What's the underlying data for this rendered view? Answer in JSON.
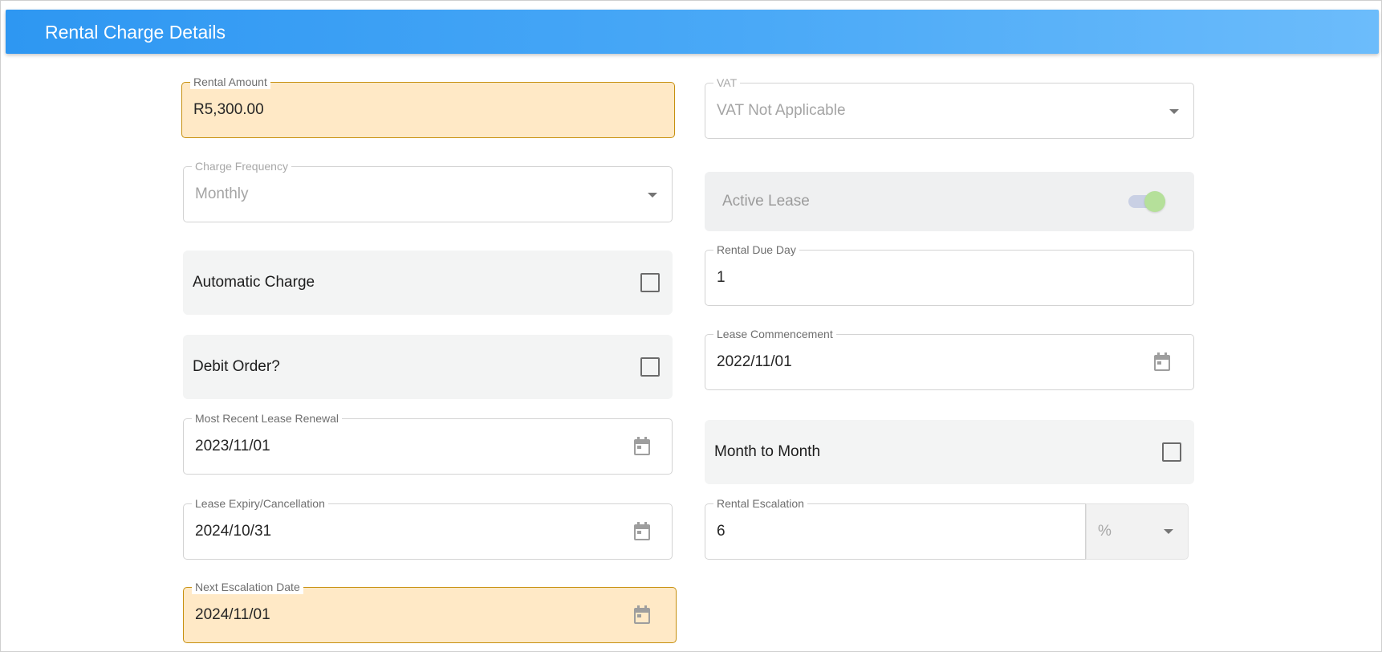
{
  "header": {
    "title": "Rental Charge Details"
  },
  "fields": {
    "rental_amount": {
      "label": "Rental Amount",
      "value": "R5,300.00"
    },
    "vat": {
      "label": "VAT",
      "value": "VAT Not Applicable"
    },
    "charge_frequency": {
      "label": "Charge Frequency",
      "value": "Monthly"
    },
    "active_lease": {
      "label": "Active Lease",
      "checked": true
    },
    "automatic_charge": {
      "label": "Automatic Charge",
      "checked": false
    },
    "rental_due_day": {
      "label": "Rental Due Day",
      "value": "1"
    },
    "debit_order": {
      "label": "Debit Order?",
      "checked": false
    },
    "lease_commencement": {
      "label": "Lease Commencement",
      "value": "2022/11/01"
    },
    "most_recent_lease_renewal": {
      "label": "Most Recent Lease Renewal",
      "value": "2023/11/01"
    },
    "month_to_month": {
      "label": "Month to Month",
      "checked": false
    },
    "lease_expiry": {
      "label": "Lease Expiry/Cancellation",
      "value": "2024/10/31"
    },
    "rental_escalation": {
      "label": "Rental Escalation",
      "value": "6",
      "unit": "%"
    },
    "next_escalation_date": {
      "label": "Next Escalation Date",
      "value": "2024/11/01"
    }
  },
  "icons": {
    "calendar": "calendar-icon",
    "dropdown": "chevron-down-icon"
  },
  "colors": {
    "header_gradient_start": "#2e97f2",
    "header_gradient_end": "#6cbcfb",
    "highlight_fill": "#ffe9c6",
    "highlight_border": "#c7900f",
    "toggle_knob": "#b5e09a"
  }
}
